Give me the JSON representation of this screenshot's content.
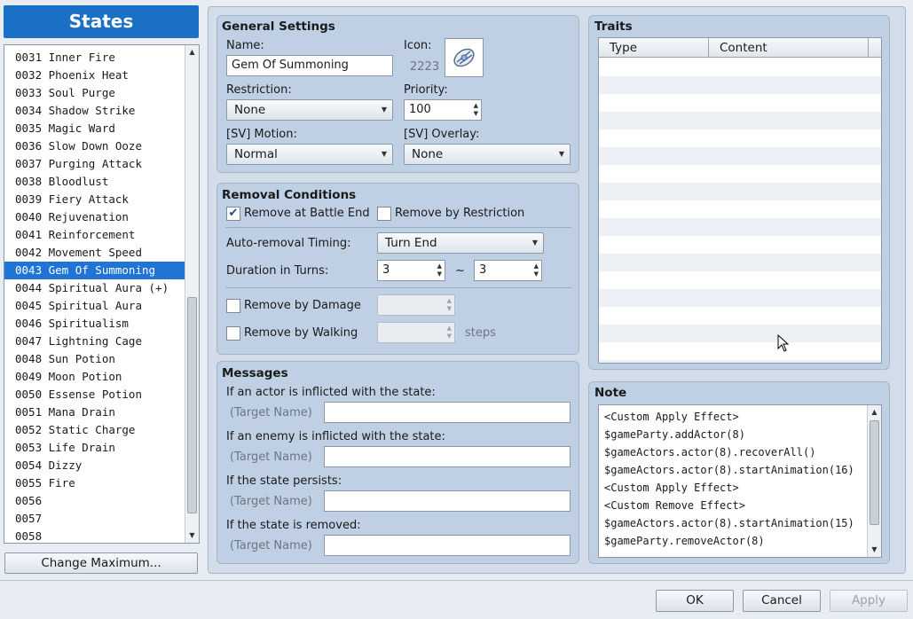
{
  "left_title": "States",
  "states": [
    "0031 Inner Fire",
    "0032 Phoenix Heat",
    "0033 Soul Purge",
    "0034 Shadow Strike",
    "0035 Magic Ward",
    "0036 Slow Down Ooze",
    "0037 Purging Attack",
    "0038 Bloodlust",
    "0039 Fiery Attack",
    "0040 Rejuvenation",
    "0041 Reinforcement",
    "0042 Movement Speed",
    "0043 Gem Of Summoning",
    "0044 Spiritual Aura (+)",
    "0045 Spiritual Aura",
    "0046 Spiritualism",
    "0047 Lightning Cage",
    "0048 Sun Potion",
    "0049 Moon Potion",
    "0050 Essense Potion",
    "0051 Mana Drain",
    "0052 Static Charge",
    "0053 Life Drain",
    "0054 Dizzy",
    "0055 Fire",
    "0056",
    "0057",
    "0058"
  ],
  "selected_state": "0043 Gem Of Summoning",
  "change_max_label": "Change Maximum...",
  "general": {
    "title": "General Settings",
    "name_label": "Name:",
    "name_value": "Gem Of Summoning",
    "icon_label": "Icon:",
    "icon_index": "2223",
    "restriction_label": "Restriction:",
    "restriction_value": "None",
    "priority_label": "Priority:",
    "priority_value": "100",
    "motion_label": "[SV] Motion:",
    "motion_value": "Normal",
    "overlay_label": "[SV] Overlay:",
    "overlay_value": "None"
  },
  "removal": {
    "title": "Removal Conditions",
    "battle_end_label": "Remove at Battle End",
    "battle_end_checked": true,
    "restriction_label": "Remove by Restriction",
    "restriction_checked": false,
    "timing_label": "Auto-removal Timing:",
    "timing_value": "Turn End",
    "duration_label": "Duration in Turns:",
    "duration_min": "3",
    "tilde": "~",
    "duration_max": "3",
    "damage_label": "Remove by Damage",
    "damage_checked": false,
    "walking_label": "Remove by Walking",
    "walking_checked": false,
    "steps_label": "steps"
  },
  "messages": {
    "title": "Messages",
    "target_placeholder": "(Target Name)",
    "items": [
      {
        "label": "If an actor is inflicted with the state:",
        "value": ""
      },
      {
        "label": "If an enemy is inflicted with the state:",
        "value": ""
      },
      {
        "label": "If the state persists:",
        "value": ""
      },
      {
        "label": "If the state is removed:",
        "value": ""
      }
    ]
  },
  "traits": {
    "title": "Traits",
    "col_type": "Type",
    "col_content": "Content"
  },
  "note": {
    "title": "Note",
    "lines": [
      "<Custom Apply Effect>",
      "$gameParty.addActor(8)",
      "$gameActors.actor(8).recoverAll()",
      "$gameActors.actor(8).startAnimation(16)",
      "<Custom Apply Effect>",
      "<Custom Remove Effect>",
      "$gameActors.actor(8).startAnimation(15)",
      "$gameParty.removeActor(8)"
    ]
  },
  "buttons": {
    "ok": "OK",
    "cancel": "Cancel",
    "apply": "Apply"
  },
  "colors": {
    "selection": "#1f74d6",
    "title_bar": "#1b6fc4"
  }
}
